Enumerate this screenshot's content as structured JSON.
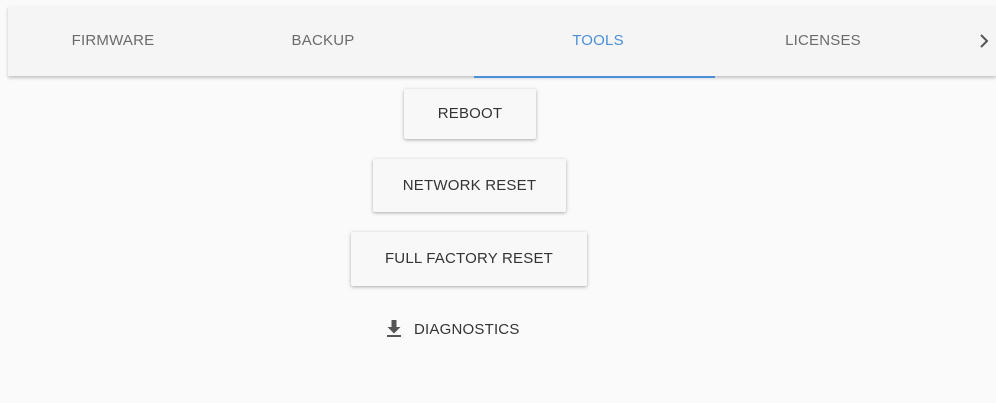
{
  "tabs": [
    {
      "label": "FIRMWARE",
      "active": false
    },
    {
      "label": "BACKUP",
      "active": false
    },
    {
      "label": "TOOLS",
      "active": true
    },
    {
      "label": "LICENSES",
      "active": false
    }
  ],
  "tab_nav": {
    "next_icon": "chevron-right-icon"
  },
  "tools": {
    "reboot_label": "REBOOT",
    "network_reset_label": "NETWORK RESET",
    "full_factory_reset_label": "FULL FACTORY RESET",
    "diagnostics_label": "DIAGNOSTICS",
    "diagnostics_icon": "download-icon"
  },
  "colors": {
    "accent": "#4a90d9",
    "tab_bar_bg": "#f5f5f5",
    "page_bg": "#fafafa",
    "inactive_tab_text": "#6b6b6b"
  }
}
